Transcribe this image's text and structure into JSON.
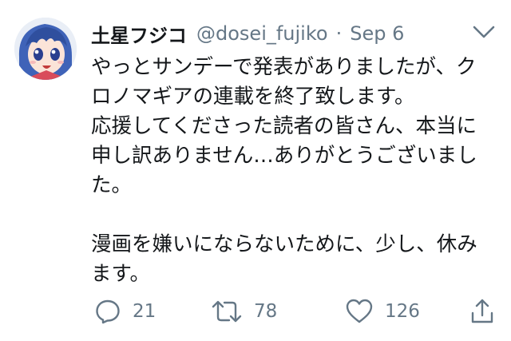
{
  "tweet": {
    "author": {
      "display_name": "土星フジコ",
      "handle": "@dosei_fujiko",
      "avatar": "anime-girl-avatar"
    },
    "separator": "·",
    "date": "Sep 6",
    "menu_icon": "chevron-down-icon",
    "text_lines": [
      "やっとサンデーで発表がありましたが、ク",
      "ロノマギアの連載を終了致します。",
      "応援してくださった読者の皆さん、本当に",
      "申し訳ありません…ありがとうございまし",
      "た。",
      "",
      "漫画を嫌いにならないために、少し、休み",
      "ます。"
    ],
    "actions": {
      "reply": {
        "icon": "reply-icon",
        "count": "21"
      },
      "retweet": {
        "icon": "retweet-icon",
        "count": "78"
      },
      "like": {
        "icon": "heart-icon",
        "count": "126"
      },
      "share": {
        "icon": "share-icon"
      }
    },
    "colors": {
      "text": "#14171a",
      "secondary": "#657786",
      "background": "#ffffff"
    }
  }
}
